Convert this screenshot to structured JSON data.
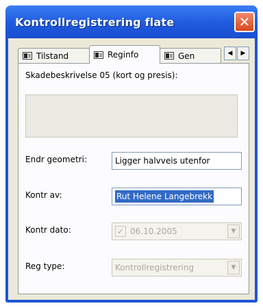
{
  "window": {
    "title": "Kontrollregistrering flate",
    "close_glyph": "✕"
  },
  "tabs": [
    {
      "label": "Tilstand",
      "icon": "tab-document-icon"
    },
    {
      "label": "Reginfo",
      "icon": "tab-document-icon"
    },
    {
      "label": "Gen",
      "icon": "tab-document-icon"
    }
  ],
  "tab_scroll": {
    "left": "◀",
    "right": "▶"
  },
  "form": {
    "desc_label": "Skadebeskrivelse 05 (kort og presis):",
    "desc_value": "",
    "geometry_label": "Endr geometri:",
    "geometry_value": "Ligger halvveis utenfor",
    "controlled_by_label": "Kontr av:",
    "controlled_by_value": "Rut Helene Langebrekk",
    "control_date_label": "Kontr dato:",
    "control_date_checked": "✓",
    "control_date_value": "06.10.2005",
    "reg_type_label": "Reg type:",
    "reg_type_value": "Kontrollregistrering",
    "dropdown_glyph": "▼"
  },
  "colors": {
    "titlebar": "#1f54d6",
    "close": "#d9481c",
    "selection": "#316ac5"
  }
}
